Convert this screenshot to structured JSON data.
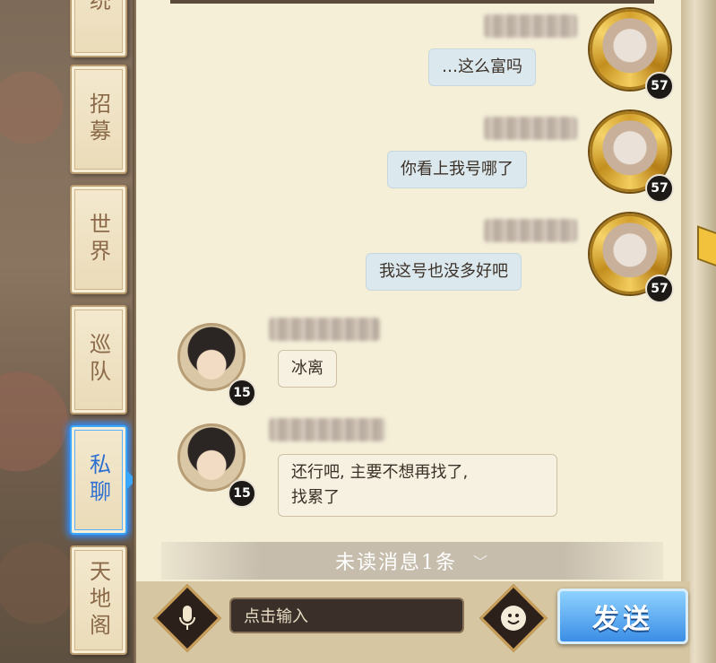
{
  "tabs": [
    {
      "label": "统",
      "active": false
    },
    {
      "label": "招募",
      "active": false
    },
    {
      "label": "世界",
      "active": false
    },
    {
      "label": "巡队",
      "active": false
    },
    {
      "label": "私聊",
      "active": true
    },
    {
      "label": "天地阁",
      "active": false
    }
  ],
  "messages": [
    {
      "side": "right",
      "text": "…这么富吗",
      "level": "57"
    },
    {
      "side": "right",
      "text": "你看上我号哪了",
      "level": "57"
    },
    {
      "side": "right",
      "text": "我这号也没多好吧",
      "level": "57"
    },
    {
      "side": "left",
      "text": "冰离",
      "level": "15"
    },
    {
      "side": "left",
      "text": "还行吧, 主要不想再找了,",
      "text2": "找累了",
      "level": "15"
    }
  ],
  "unread": {
    "label": "未读消息1条"
  },
  "input": {
    "placeholder": "点击输入"
  },
  "send": {
    "label": "发送"
  },
  "colors": {
    "active_tab": "#3aa7ff",
    "send_button": "#3b8ee6",
    "panel": "#f5efd8"
  }
}
